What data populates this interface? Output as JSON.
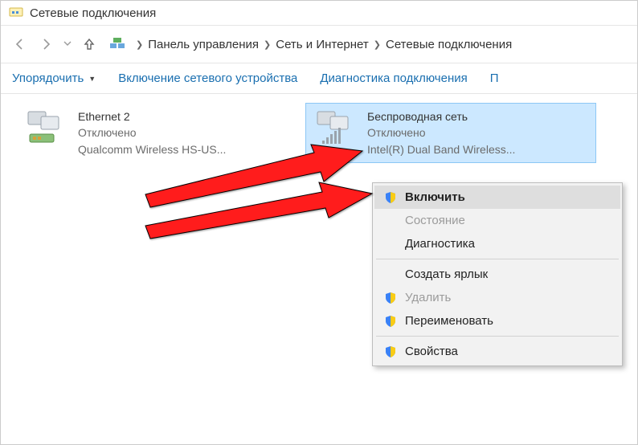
{
  "window": {
    "title": "Сетевые подключения"
  },
  "breadcrumb": {
    "item0": "Панель управления",
    "item1": "Сеть и Интернет",
    "item2": "Сетевые подключения"
  },
  "toolbar": {
    "organize": "Упорядочить",
    "enable": "Включение сетевого устройства",
    "diagnose": "Диагностика подключения",
    "more": "П"
  },
  "adapters": {
    "eth": {
      "name": "Ethernet 2",
      "status": "Отключено",
      "hw": "Qualcomm Wireless HS-US..."
    },
    "wifi": {
      "name": "Беспроводная сеть",
      "status": "Отключено",
      "hw": "Intel(R) Dual Band Wireless..."
    }
  },
  "menu": {
    "enable": "Включить",
    "status": "Состояние",
    "diagnose": "Диагностика",
    "shortcut": "Создать ярлык",
    "delete": "Удалить",
    "rename": "Переименовать",
    "properties": "Свойства"
  }
}
